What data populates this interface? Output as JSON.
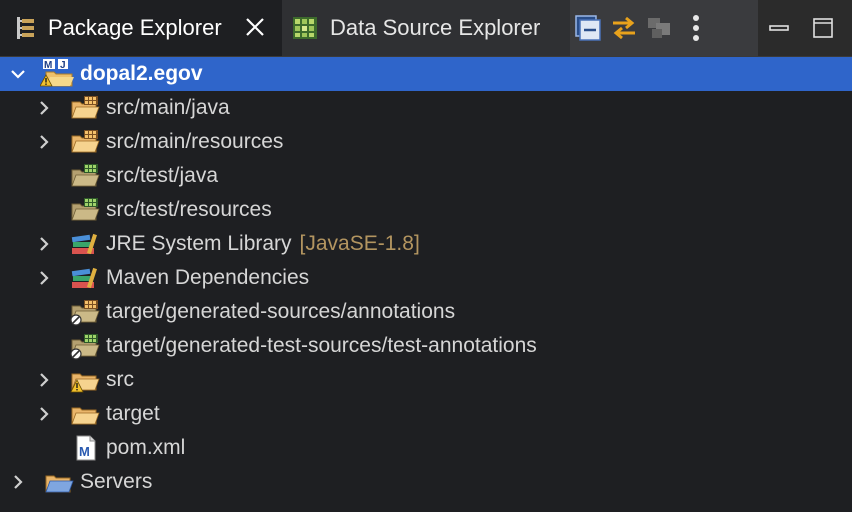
{
  "tabs": {
    "package_explorer": "Package Explorer",
    "data_source_explorer": "Data Source Explorer"
  },
  "tree": {
    "project": {
      "label": "dopal2.egov"
    },
    "items": [
      {
        "label": "src/main/java",
        "expandable": true,
        "icon": "source-folder-icon"
      },
      {
        "label": "src/main/resources",
        "expandable": true,
        "icon": "source-folder-icon"
      },
      {
        "label": "src/test/java",
        "expandable": false,
        "icon": "test-source-folder-icon"
      },
      {
        "label": "src/test/resources",
        "expandable": false,
        "icon": "test-source-folder-icon"
      },
      {
        "label": "JRE System Library",
        "decoration": "[JavaSE-1.8]",
        "expandable": true,
        "icon": "library-icon"
      },
      {
        "label": "Maven Dependencies",
        "expandable": true,
        "icon": "library-icon"
      },
      {
        "label": "target/generated-sources/annotations",
        "expandable": false,
        "icon": "generated-source-folder-icon"
      },
      {
        "label": "target/generated-test-sources/test-annotations",
        "expandable": false,
        "icon": "generated-test-folder-icon"
      },
      {
        "label": "src",
        "expandable": true,
        "icon": "warning-folder-icon"
      },
      {
        "label": "target",
        "expandable": true,
        "icon": "folder-icon"
      },
      {
        "label": "pom.xml",
        "expandable": false,
        "icon": "maven-file-icon"
      }
    ],
    "servers": {
      "label": "Servers"
    }
  },
  "colors": {
    "selection": "#2f65ca",
    "background": "#1e1f22",
    "decoration": "#b39560"
  }
}
